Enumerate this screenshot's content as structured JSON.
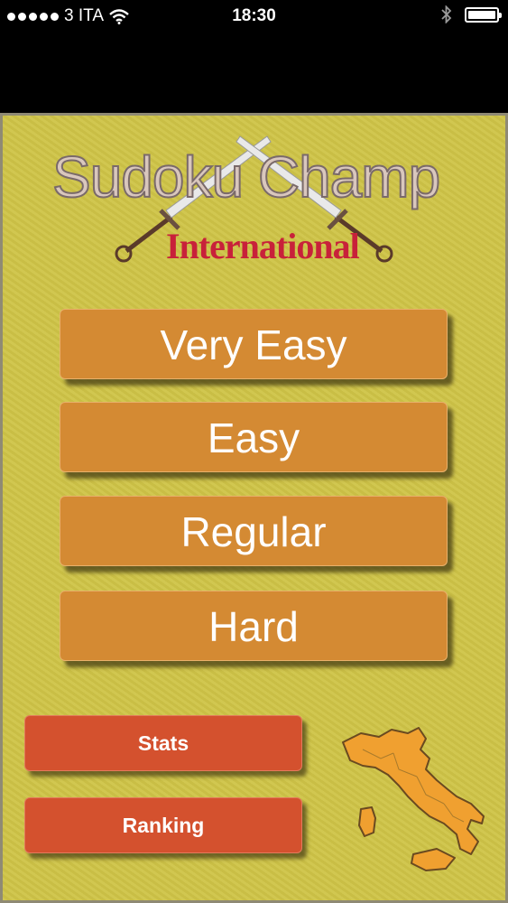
{
  "status_bar": {
    "carrier": "3 ITA",
    "time": "18:30",
    "signal_bars": 5,
    "battery_level": 1.0,
    "icons": [
      "signal-dots-icon",
      "wifi-icon",
      "bluetooth-icon",
      "battery-icon"
    ]
  },
  "logo": {
    "title": "Sudoku Champ",
    "subtitle": "International",
    "emblem": "crossed-swords-icon"
  },
  "difficulty": {
    "buttons": [
      {
        "label": "Very Easy"
      },
      {
        "label": "Easy"
      },
      {
        "label": "Regular"
      },
      {
        "label": "Hard"
      }
    ]
  },
  "footer": {
    "stats_label": "Stats",
    "ranking_label": "Ranking",
    "map_icon": "italy-map-icon"
  },
  "colors": {
    "background": "#cfc447",
    "difficulty_button": "#d48a33",
    "secondary_button": "#d4512e",
    "subtitle_red": "#c8213a",
    "map_orange": "#f0a030"
  }
}
